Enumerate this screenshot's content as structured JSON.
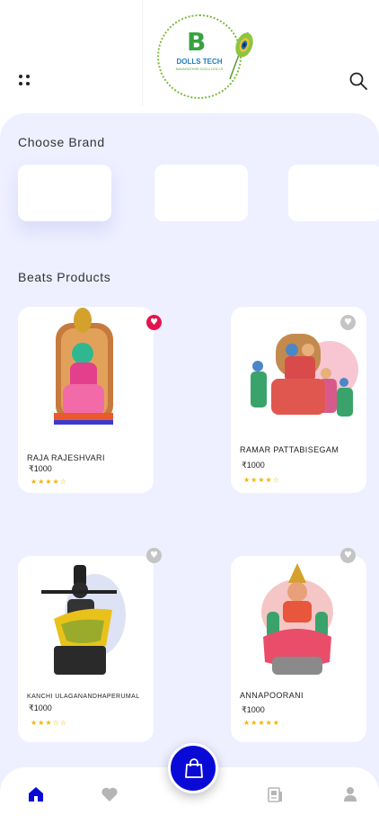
{
  "header": {
    "logo": {
      "title": "DOLLS TECH",
      "subtitle": "NAVARATHIRI GOLU DOLLS",
      "letter": "B"
    },
    "menu_icon": "grid-dots-icon",
    "search_icon": "search-icon"
  },
  "brands": {
    "title": "Choose Brand",
    "items": [
      {},
      {},
      {}
    ]
  },
  "products": {
    "title": "Beats Products",
    "items": [
      {
        "name": "RAJA RAJESHVARI",
        "price": "₹1000",
        "rating": "★★★★☆",
        "favorite": true
      },
      {
        "name": "RAMAR PATTABISEGAM",
        "price": "₹1000",
        "rating": "★★★★☆",
        "favorite": false
      },
      {
        "name": "KANCHI ULAGANANDHAPERUMAL",
        "price": "₹1000",
        "rating": "★★★☆☆",
        "favorite": false
      },
      {
        "name": "ANNAPOORANI",
        "price": "₹1000",
        "rating": "★★★★★",
        "favorite": false
      }
    ]
  },
  "bottom_nav": {
    "items": [
      "home-icon",
      "heart-icon",
      "cart-bag-icon",
      "orders-icon",
      "profile-icon"
    ],
    "active": "home-icon"
  },
  "colors": {
    "accent": "#0a0ad6",
    "favorite": "#e3144d",
    "panel": "#eeefff",
    "star": "#f4b400"
  }
}
